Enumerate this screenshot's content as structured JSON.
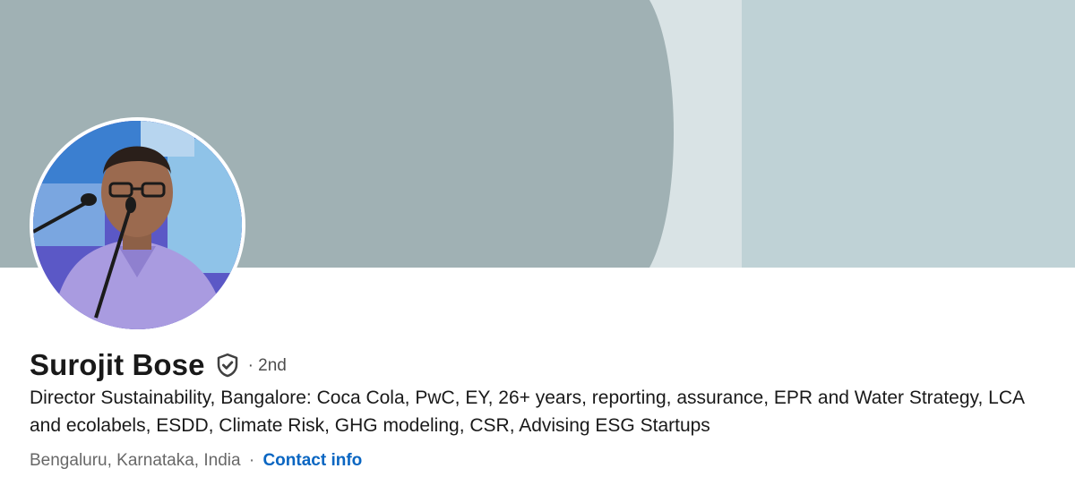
{
  "profile": {
    "name": "Surojit Bose",
    "connection_degree": "· 2nd",
    "headline": "Director Sustainability, Bangalore: Coca Cola, PwC, EY, 26+ years, reporting, assurance, EPR and Water Strategy, LCA and ecolabels, ESDD, Climate Risk, GHG modeling, CSR, Advising ESG Startups",
    "location": "Bengaluru, Karnataka, India",
    "separator": "·",
    "contact_info_label": "Contact info",
    "verified_icon": "shield-check-icon"
  },
  "colors": {
    "link": "#0a66c2",
    "cover_left": "#a0b1b4",
    "cover_stripe": "#d9e3e5",
    "cover_right": "#bfd2d6"
  }
}
